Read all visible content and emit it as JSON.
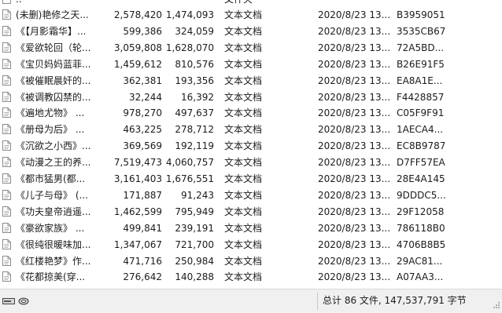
{
  "file_list": {
    "header_row": {
      "name": "..",
      "type": "文件夹"
    },
    "rows": [
      {
        "name": "(未删)艳修之天...",
        "size": "2,578,420",
        "packed": "1,474,093",
        "type": "文本文档",
        "modified": "2020/8/23 13...",
        "crc": "B3959051"
      },
      {
        "name": "《【月影霜华】...",
        "size": "599,386",
        "packed": "324,059",
        "type": "文本文档",
        "modified": "2020/8/23 13...",
        "crc": "3535CB67"
      },
      {
        "name": "《爱欲轮回（轮...",
        "size": "3,059,808",
        "packed": "1,628,070",
        "type": "文本文档",
        "modified": "2020/8/23 13...",
        "crc": "72A5BD..."
      },
      {
        "name": "《宝贝妈妈蓝菲...",
        "size": "1,459,612",
        "packed": "810,576",
        "type": "文本文档",
        "modified": "2020/8/23 13...",
        "crc": "B26E91F5"
      },
      {
        "name": "《被催眠晨奸的...",
        "size": "362,381",
        "packed": "193,356",
        "type": "文本文档",
        "modified": "2020/8/23 13...",
        "crc": "EA8A1E..."
      },
      {
        "name": "《被调教囚禁的...",
        "size": "32,244",
        "packed": "16,392",
        "type": "文本文档",
        "modified": "2020/8/23 13...",
        "crc": "F4428857"
      },
      {
        "name": "《遍地尤物》 ...",
        "size": "978,270",
        "packed": "497,637",
        "type": "文本文档",
        "modified": "2020/8/23 13...",
        "crc": "C05F9F91"
      },
      {
        "name": "《册母为后》 ...",
        "size": "463,225",
        "packed": "278,712",
        "type": "文本文档",
        "modified": "2020/8/23 13...",
        "crc": "1AECA4..."
      },
      {
        "name": "《沉欲之小西》...",
        "size": "369,569",
        "packed": "192,119",
        "type": "文本文档",
        "modified": "2020/8/23 13...",
        "crc": "EC8B9787"
      },
      {
        "name": "《动漫之王的养...",
        "size": "7,519,473",
        "packed": "4,060,757",
        "type": "文本文档",
        "modified": "2020/8/23 13...",
        "crc": "D7FF57EA"
      },
      {
        "name": "《都市猛男(都...",
        "size": "3,161,403",
        "packed": "1,676,551",
        "type": "文本文档",
        "modified": "2020/8/23 13...",
        "crc": "28E4A145"
      },
      {
        "name": "《儿子与母》 (...",
        "size": "171,887",
        "packed": "91,243",
        "type": "文本文档",
        "modified": "2020/8/23 13...",
        "crc": "9DDDC5..."
      },
      {
        "name": "《功夫皇帝逍遥...",
        "size": "1,462,599",
        "packed": "795,949",
        "type": "文本文档",
        "modified": "2020/8/23 13...",
        "crc": "29F12058"
      },
      {
        "name": "《豪欲家族》 ...",
        "size": "499,841",
        "packed": "239,191",
        "type": "文本文档",
        "modified": "2020/8/23 13...",
        "crc": "786118B0"
      },
      {
        "name": "《很纯很暖味加...",
        "size": "1,347,067",
        "packed": "721,700",
        "type": "文本文档",
        "modified": "2020/8/23 13...",
        "crc": "4706B8B5"
      },
      {
        "name": "《红楼艳梦》作...",
        "size": "471,716",
        "packed": "250,984",
        "type": "文本文档",
        "modified": "2020/8/23 13...",
        "crc": "29AC81..."
      },
      {
        "name": "《花都掠美(穿...",
        "size": "276,642",
        "packed": "140,288",
        "type": "文本文档",
        "modified": "2020/8/23 13...",
        "crc": "A07AA3..."
      }
    ]
  },
  "status_bar": {
    "summary": "总计 86 文件, 147,537,791 字节"
  },
  "colors": {
    "status_bg": "#f0f0f0",
    "text": "#1b1b1b"
  }
}
